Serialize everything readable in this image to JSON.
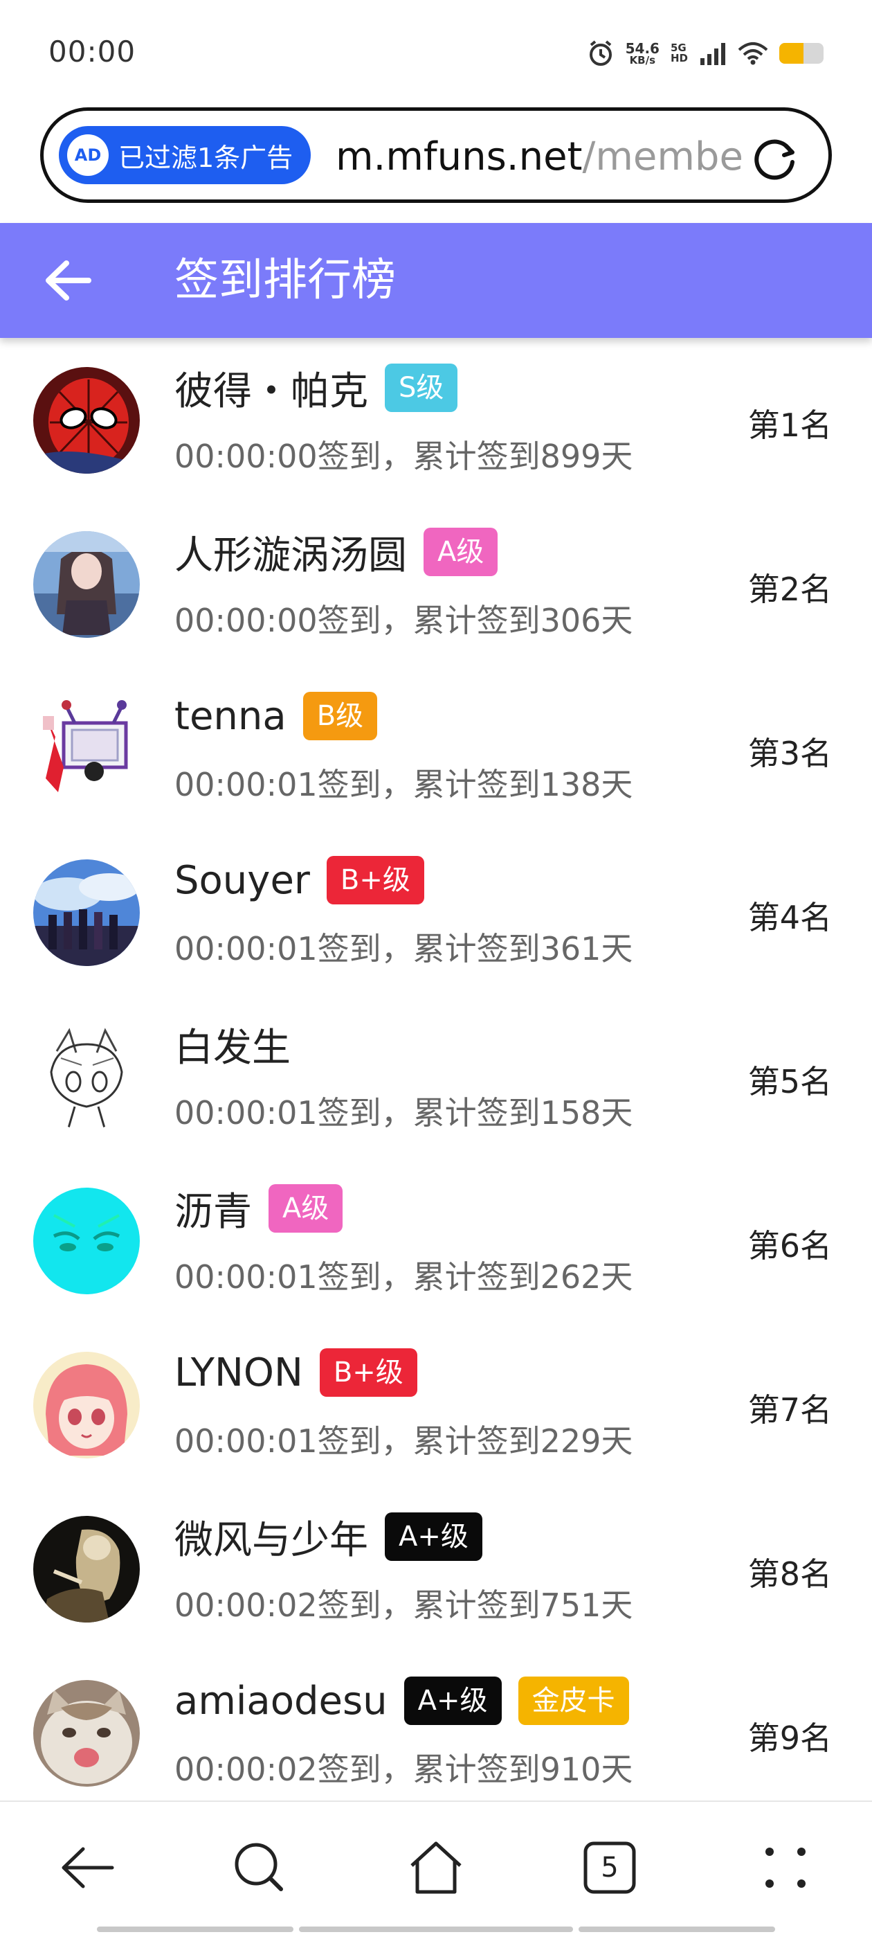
{
  "status_bar": {
    "time": "00:00",
    "speed_value": "54.6",
    "speed_unit": "KB/s",
    "network_top": "5G",
    "network_bottom": "HD",
    "battery_level": 0.55,
    "battery_color": "#f5b400",
    "icons": [
      "alarm-icon",
      "signal-icon",
      "wifi-icon",
      "battery-icon"
    ]
  },
  "browser": {
    "ad_badge_text": "已过滤1条广告",
    "ad_icon_text": "AD",
    "url_host": "m.mfuns.net",
    "url_path": "/membe",
    "reload_icon": "reload-icon"
  },
  "header": {
    "title": "签到排行榜",
    "back_icon": "back-arrow-icon",
    "bg_color": "#7b7bfa"
  },
  "rankings": [
    {
      "name": "彼得・帕克",
      "badges": [
        {
          "text": "S级",
          "color": "#4cc9e4"
        }
      ],
      "sub": "00:00:00签到，累计签到899天",
      "rank": "第1名",
      "avatar": "spiderman"
    },
    {
      "name": "人形漩涡汤圆",
      "badges": [
        {
          "text": "A级",
          "color": "#f066c0"
        }
      ],
      "sub": "00:00:00签到，累计签到306天",
      "rank": "第2名",
      "avatar": "anime-girl-dark"
    },
    {
      "name": "tenna",
      "badges": [
        {
          "text": "B级",
          "color": "#f59a10"
        }
      ],
      "sub": "00:00:01签到，累计签到138天",
      "rank": "第3名",
      "avatar": "pixel-tv"
    },
    {
      "name": "Souyer",
      "badges": [
        {
          "text": "B+级",
          "color": "#ec2638"
        }
      ],
      "sub": "00:00:01签到，累计签到361天",
      "rank": "第4名",
      "avatar": "group-sky"
    },
    {
      "name": "白发生",
      "badges": [],
      "sub": "00:00:01签到，累计签到158天",
      "rank": "第5名",
      "avatar": "sketch-catgirl"
    },
    {
      "name": "沥青",
      "badges": [
        {
          "text": "A级",
          "color": "#f066c0"
        }
      ],
      "sub": "00:00:01签到，累计签到262天",
      "rank": "第6名",
      "avatar": "cyan-face"
    },
    {
      "name": "LYNON",
      "badges": [
        {
          "text": "B+级",
          "color": "#ec2638"
        }
      ],
      "sub": "00:00:01签到，累计签到229天",
      "rank": "第7名",
      "avatar": "pink-hair-girl"
    },
    {
      "name": "微风与少年",
      "badges": [
        {
          "text": "A+级",
          "color": "#0a0a0a"
        }
      ],
      "sub": "00:00:02签到，累计签到751天",
      "rank": "第8名",
      "avatar": "dark-painting"
    },
    {
      "name": "amiaodesu",
      "badges": [
        {
          "text": "A+级",
          "color": "#0a0a0a"
        },
        {
          "text": "金皮卡",
          "color": "#f5b400"
        }
      ],
      "sub": "00:00:02签到，累计签到910天",
      "rank": "第9名",
      "avatar": "cat-photo"
    }
  ],
  "bottom_nav": {
    "items": [
      "back-icon",
      "search-icon",
      "home-icon",
      "tabs-icon",
      "menu-icon"
    ],
    "tab_count": "5"
  }
}
